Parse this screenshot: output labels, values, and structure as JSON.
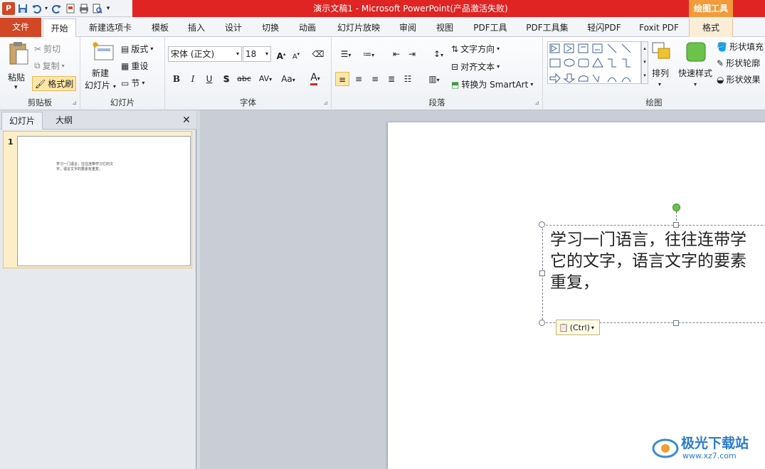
{
  "app": {
    "window_title": "演示文稿1 - Microsoft PowerPoint(产品激活失败)",
    "context_tool_title": "绘图工具"
  },
  "tabs": {
    "file": "文件",
    "items": [
      "开始",
      "新建选项卡",
      "模板",
      "插入",
      "设计",
      "切换",
      "动画",
      "幻灯片放映",
      "审阅",
      "视图",
      "PDF工具",
      "PDF工具集",
      "轻闪PDF",
      "Foxit PDF",
      "格式"
    ]
  },
  "ribbon": {
    "clipboard": {
      "paste": "粘贴",
      "cut": "剪切",
      "copy": "复制",
      "format_painter": "格式刷",
      "label": "剪贴板"
    },
    "slides": {
      "new_slide_line1": "新建",
      "new_slide_line2": "幻灯片",
      "layout": "版式",
      "reset": "重设",
      "section": "节",
      "label": "幻灯片"
    },
    "font": {
      "font_name": "宋体 (正文)",
      "font_size": "18",
      "label": "字体",
      "bold": "B",
      "italic": "I",
      "underline": "U",
      "shadow": "S",
      "strike": "abc",
      "spacing": "AV",
      "case": "Aa",
      "color": "A",
      "grow": "A",
      "shrink": "A"
    },
    "paragraph": {
      "text_direction": "文字方向",
      "align_text": "对齐文本",
      "convert_smartart": "转换为 SmartArt",
      "label": "段落"
    },
    "drawing": {
      "arrange": "排列",
      "quick_styles": "快速样式",
      "shape_fill": "形状填充",
      "shape_outline": "形状轮廓",
      "shape_effects": "形状效果",
      "label": "绘图"
    }
  },
  "panel": {
    "tab_slides": "幻灯片",
    "tab_outline": "大纲",
    "close": "✕",
    "slide_number": "1",
    "thumb_text": "学习一门语言，往往连带学习它的文字，语言文字的要素有重复，"
  },
  "slide": {
    "text_lines": [
      "学习一门语言，往往连带学",
      "它的文字，语言文字的要素",
      "重复，"
    ]
  },
  "paste_options": {
    "label": "(Ctrl)"
  },
  "watermark": {
    "text": "极光下载站",
    "url": "www.xz7.com"
  },
  "colors": {
    "title_red": "#e02424",
    "file_tab": "#d24726",
    "context_orange": "#f39a3a",
    "selection_yellow": "#fcefc7"
  }
}
